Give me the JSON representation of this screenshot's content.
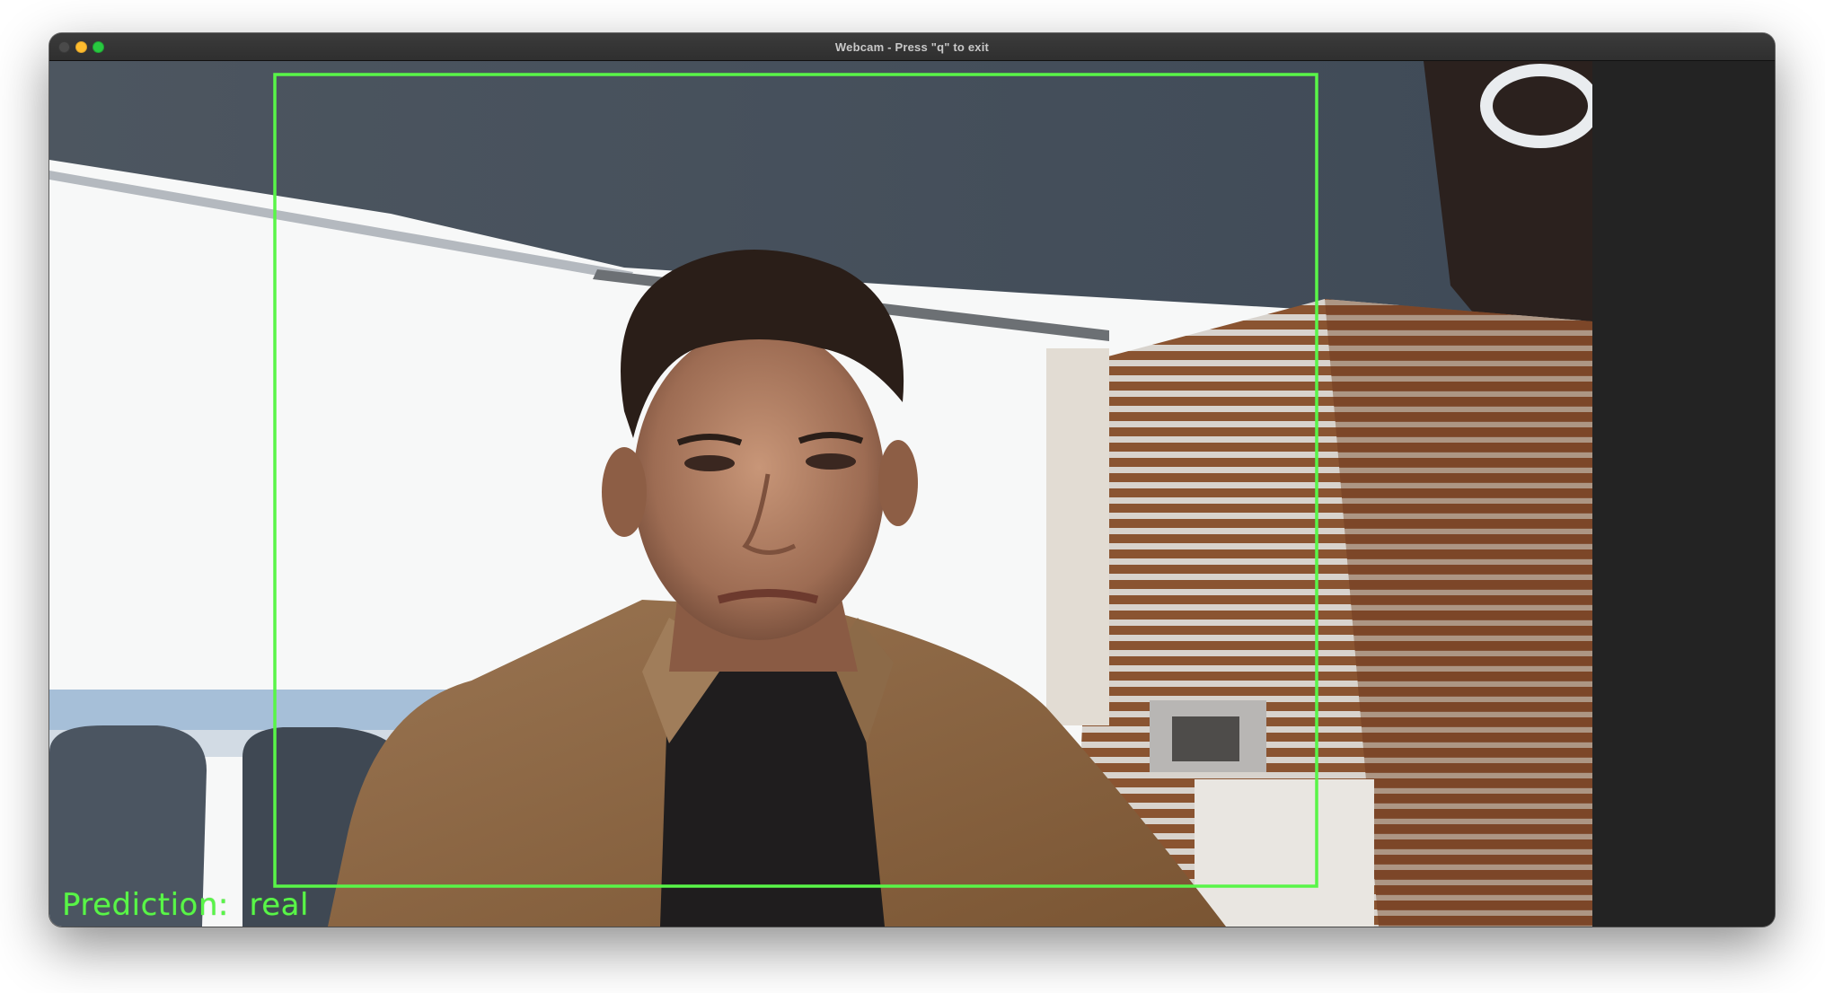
{
  "window": {
    "title": "Webcam - Press \"q\" to exit"
  },
  "overlay": {
    "prediction_text": "Prediction:  real",
    "box_color": "#59f548"
  }
}
